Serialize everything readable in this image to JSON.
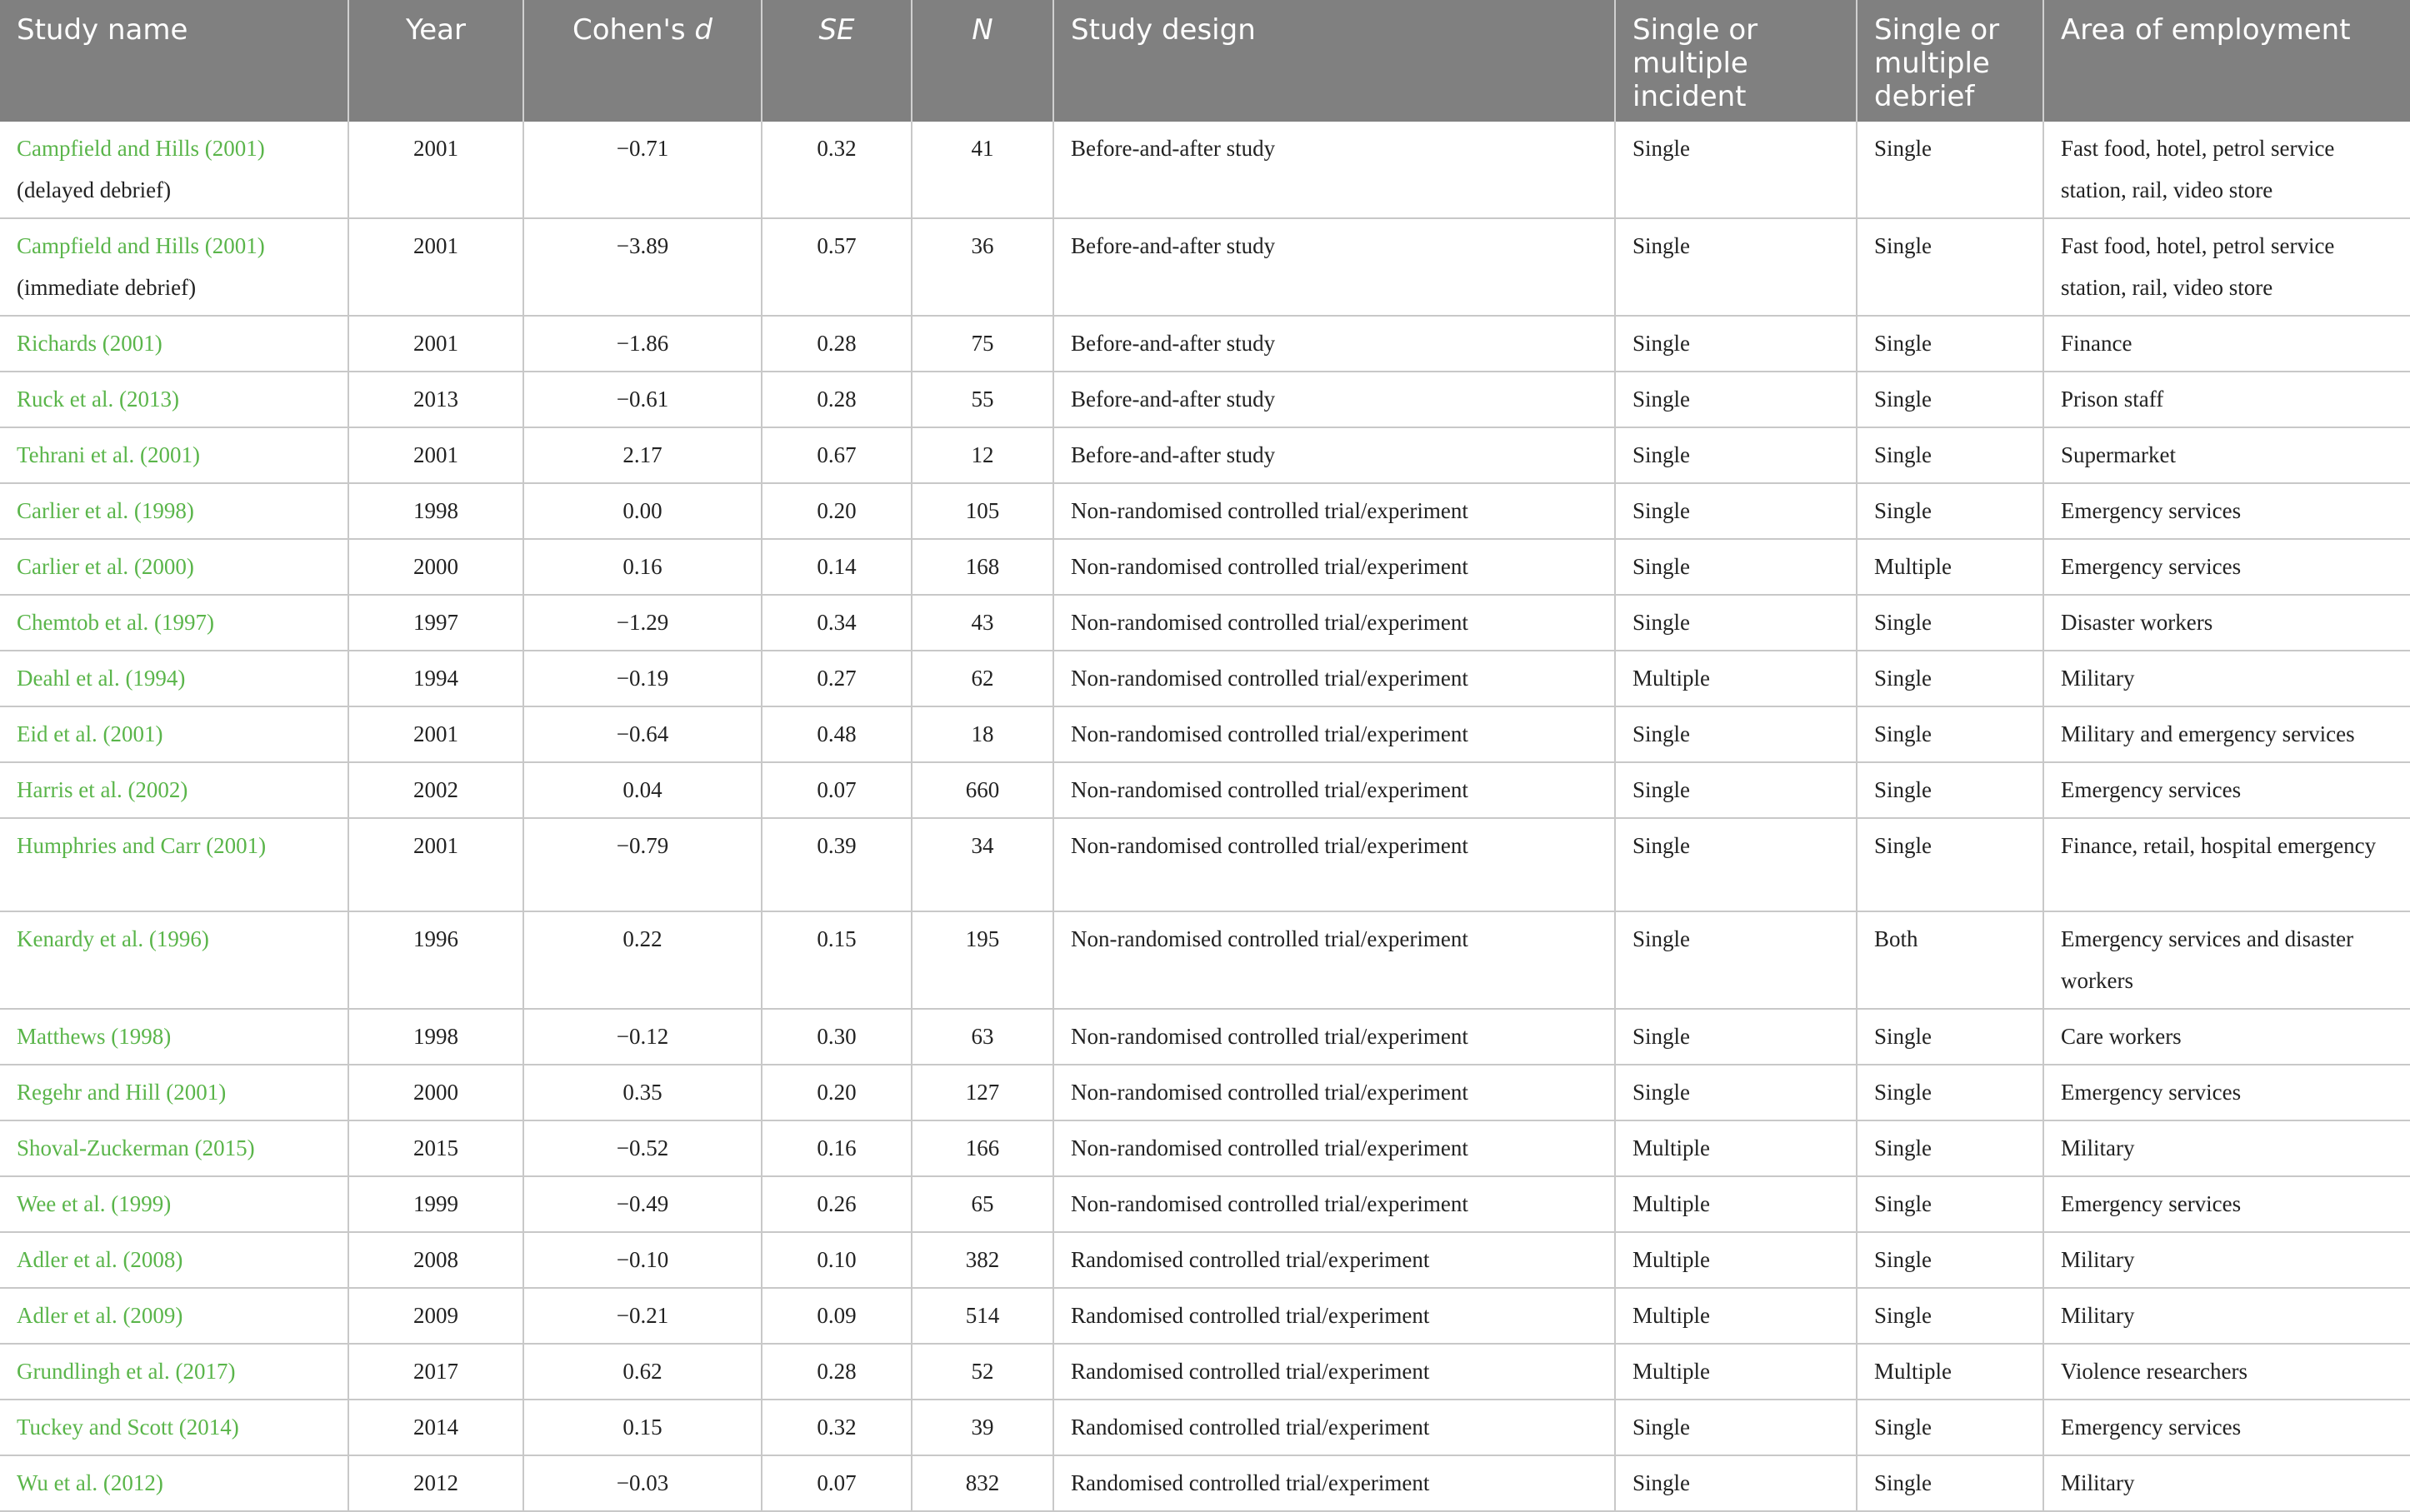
{
  "table": {
    "headers": {
      "study_name": "Study name",
      "year": "Year",
      "cohens_d_prefix": "Cohen's ",
      "cohens_d_symbol": "d",
      "se": "SE",
      "n": "N",
      "study_design": "Study design",
      "incident": "Single or multiple incident",
      "debrief": "Single or multiple debrief",
      "area": "Area of employment"
    },
    "rows": [
      {
        "cite": "Campfield and Hills (2001)",
        "sub": "(delayed debrief)",
        "year": "2001",
        "d": "−0.71",
        "se": "0.32",
        "n": "41",
        "design": "Before-and-after study",
        "incident": "Single",
        "debrief": "Single",
        "area": "Fast food, hotel, petrol service station, rail, video store"
      },
      {
        "cite": "Campfield and Hills (2001)",
        "sub": "(immediate debrief)",
        "year": "2001",
        "d": "−3.89",
        "se": "0.57",
        "n": "36",
        "design": "Before-and-after study",
        "incident": "Single",
        "debrief": "Single",
        "area": "Fast food, hotel, petrol service station, rail, video store"
      },
      {
        "cite": "Richards (2001)",
        "sub": "",
        "year": "2001",
        "d": "−1.86",
        "se": "0.28",
        "n": "75",
        "design": "Before-and-after study",
        "incident": "Single",
        "debrief": "Single",
        "area": "Finance"
      },
      {
        "cite": "Ruck et al. (2013)",
        "sub": "",
        "year": "2013",
        "d": "−0.61",
        "se": "0.28",
        "n": "55",
        "design": "Before-and-after study",
        "incident": "Single",
        "debrief": "Single",
        "area": "Prison staff"
      },
      {
        "cite": "Tehrani et al. (2001)",
        "sub": "",
        "year": "2001",
        "d": "2.17",
        "se": "0.67",
        "n": "12",
        "design": "Before-and-after study",
        "incident": "Single",
        "debrief": "Single",
        "area": "Supermarket"
      },
      {
        "cite": "Carlier et al. (1998)",
        "sub": "",
        "year": "1998",
        "d": "0.00",
        "se": "0.20",
        "n": "105",
        "design": "Non-randomised controlled trial/experiment",
        "incident": "Single",
        "debrief": "Single",
        "area": "Emergency services"
      },
      {
        "cite": "Carlier et al. (2000)",
        "sub": "",
        "year": "2000",
        "d": "0.16",
        "se": "0.14",
        "n": "168",
        "design": "Non-randomised controlled trial/experiment",
        "incident": "Single",
        "debrief": "Multiple",
        "area": "Emergency services"
      },
      {
        "cite": "Chemtob et al. (1997)",
        "sub": "",
        "year": "1997",
        "d": "−1.29",
        "se": "0.34",
        "n": "43",
        "design": "Non-randomised controlled trial/experiment",
        "incident": "Single",
        "debrief": "Single",
        "area": "Disaster workers"
      },
      {
        "cite": "Deahl et al. (1994)",
        "sub": "",
        "year": "1994",
        "d": "−0.19",
        "se": "0.27",
        "n": "62",
        "design": "Non-randomised controlled trial/experiment",
        "incident": "Multiple",
        "debrief": "Single",
        "area": "Military"
      },
      {
        "cite": "Eid et al. (2001)",
        "sub": "",
        "year": "2001",
        "d": "−0.64",
        "se": "0.48",
        "n": "18",
        "design": "Non-randomised controlled trial/experiment",
        "incident": "Single",
        "debrief": "Single",
        "area": "Military and emergency services"
      },
      {
        "cite": "Harris et al. (2002)",
        "sub": "",
        "year": "2002",
        "d": "0.04",
        "se": "0.07",
        "n": "660",
        "design": "Non-randomised controlled trial/experiment",
        "incident": "Single",
        "debrief": "Single",
        "area": "Emergency services"
      },
      {
        "cite": "Humphries and Carr (2001)",
        "sub": "",
        "year": "2001",
        "d": "−0.79",
        "se": "0.39",
        "n": "34",
        "design": "Non-randomised controlled trial/experiment",
        "incident": "Single",
        "debrief": "Single",
        "area": "Finance, retail, hospital emergency"
      },
      {
        "cite": "Kenardy et al. (1996)",
        "sub": "",
        "year": "1996",
        "d": "0.22",
        "se": "0.15",
        "n": "195",
        "design": "Non-randomised controlled trial/experiment",
        "incident": "Single",
        "debrief": "Both",
        "area": "Emergency services and disaster workers"
      },
      {
        "cite": "Matthews (1998)",
        "sub": "",
        "year": "1998",
        "d": "−0.12",
        "se": "0.30",
        "n": "63",
        "design": "Non-randomised controlled trial/experiment",
        "incident": "Single",
        "debrief": "Single",
        "area": "Care workers"
      },
      {
        "cite": "Regehr and Hill (2001)",
        "sub": "",
        "year": "2000",
        "d": "0.35",
        "se": "0.20",
        "n": "127",
        "design": "Non-randomised controlled trial/experiment",
        "incident": "Single",
        "debrief": "Single",
        "area": "Emergency services"
      },
      {
        "cite": "Shoval-Zuckerman (2015)",
        "sub": "",
        "year": "2015",
        "d": "−0.52",
        "se": "0.16",
        "n": "166",
        "design": "Non-randomised controlled trial/experiment",
        "incident": "Multiple",
        "debrief": "Single",
        "area": "Military"
      },
      {
        "cite": "Wee et al. (1999)",
        "sub": "",
        "year": "1999",
        "d": "−0.49",
        "se": "0.26",
        "n": "65",
        "design": "Non-randomised controlled trial/experiment",
        "incident": "Multiple",
        "debrief": "Single",
        "area": "Emergency services"
      },
      {
        "cite": "Adler et al. (2008)",
        "sub": "",
        "year": "2008",
        "d": "−0.10",
        "se": "0.10",
        "n": "382",
        "design": "Randomised controlled trial/experiment",
        "incident": "Multiple",
        "debrief": "Single",
        "area": "Military"
      },
      {
        "cite": "Adler et al. (2009)",
        "sub": "",
        "year": "2009",
        "d": "−0.21",
        "se": "0.09",
        "n": "514",
        "design": "Randomised controlled trial/experiment",
        "incident": "Multiple",
        "debrief": "Single",
        "area": "Military"
      },
      {
        "cite": "Grundlingh et al. (2017)",
        "sub": "",
        "year": "2017",
        "d": "0.62",
        "se": "0.28",
        "n": "52",
        "design": "Randomised controlled trial/experiment",
        "incident": "Multiple",
        "debrief": "Multiple",
        "area": "Violence researchers"
      },
      {
        "cite": "Tuckey and Scott (2014)",
        "sub": "",
        "year": "2014",
        "d": "0.15",
        "se": "0.32",
        "n": "39",
        "design": "Randomised controlled trial/experiment",
        "incident": "Single",
        "debrief": "Single",
        "area": "Emergency services"
      },
      {
        "cite": "Wu et al. (2012)",
        "sub": "",
        "year": "2012",
        "d": "−0.03",
        "se": "0.07",
        "n": "832",
        "design": "Randomised controlled trial/experiment",
        "incident": "Single",
        "debrief": "Single",
        "area": "Military"
      }
    ]
  }
}
